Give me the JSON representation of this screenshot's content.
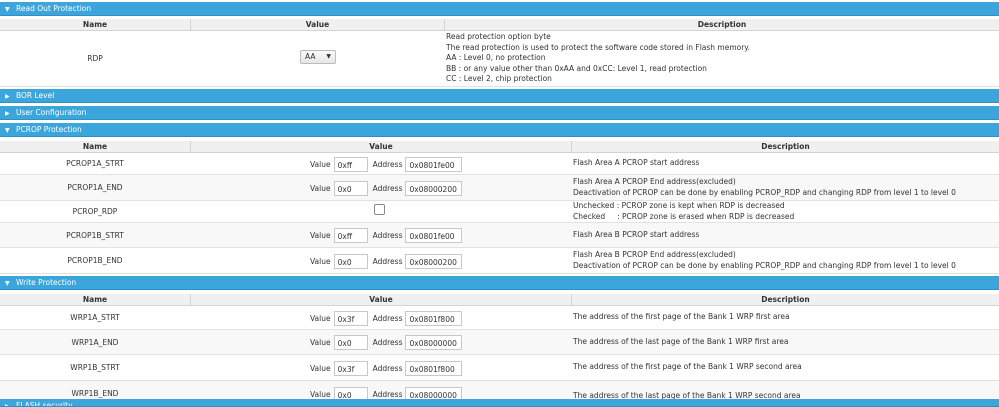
{
  "sections": {
    "rop": {
      "title": "Read Out Protection",
      "arrow": "▼"
    },
    "bor": {
      "title": "BOR Level",
      "arrow": "▶"
    },
    "user": {
      "title": "User Configuration",
      "arrow": "▶"
    },
    "pcrop": {
      "title": "PCROP Protection",
      "arrow": "▼"
    },
    "wrp": {
      "title": "Write Protection",
      "arrow": "▼"
    },
    "flash": {
      "title": "FLASH security",
      "arrow": "▶"
    }
  },
  "headers": {
    "name": "Name",
    "value": "Value",
    "description": "Description"
  },
  "labels": {
    "value": "Value",
    "address": "Address"
  },
  "rdp": {
    "name": "RDP",
    "selected": "AA",
    "desc": [
      "Read protection option byte",
      "The read protection is used to protect the software code stored in Flash memory.",
      "AA : Level 0, no protection",
      "BB : or any value other than 0xAA and 0xCC: Level 1, read protection",
      "CC : Level 2, chip protection"
    ]
  },
  "pcrop_rows": [
    {
      "name": "PCROP1A_STRT",
      "value": "0xff",
      "address": "0x0801fe00",
      "desc": [
        "Flash Area A PCROP start address"
      ]
    },
    {
      "name": "PCROP1A_END",
      "value": "0x0",
      "address": "0x08000200",
      "desc": [
        "Flash Area A PCROP End address(excluded)",
        "Deactivation of PCROP can be done by enabling PCROP_RDP and changing RDP from level 1 to level 0"
      ]
    },
    {
      "name": "PCROP_RDP",
      "checked": false,
      "desc": [
        "Unchecked : PCROP zone is kept when RDP is decreased",
        "Checked     : PCROP zone is erased when RDP is decreased"
      ]
    },
    {
      "name": "PCROP1B_STRT",
      "value": "0xff",
      "address": "0x0801fe00",
      "desc": [
        "Flash Area B PCROP start address"
      ]
    },
    {
      "name": "PCROP1B_END",
      "value": "0x0",
      "address": "0x08000200",
      "desc": [
        "Flash Area B PCROP End address(excluded)",
        "Deactivation of PCROP can be done by enabling PCROP_RDP and changing RDP from level 1 to level 0"
      ]
    }
  ],
  "wrp_rows": [
    {
      "name": "WRP1A_STRT",
      "value": "0x3f",
      "address": "0x0801f800",
      "desc": [
        "The address of the first page of the Bank 1 WRP first area"
      ]
    },
    {
      "name": "WRP1A_END",
      "value": "0x0",
      "address": "0x08000000",
      "desc": [
        "The address of the last page of the Bank 1 WRP first area"
      ]
    },
    {
      "name": "WRP1B_STRT",
      "value": "0x3f",
      "address": "0x0801f800",
      "desc": [
        "The address of the first page of the Bank 1 WRP second area"
      ]
    },
    {
      "name": "WRP1B_END",
      "value": "0x0",
      "address": "0x08000000",
      "desc": [
        "The address of the last page of the Bank 1 WRP second area"
      ]
    }
  ],
  "colors": {
    "section_bg": "#3ca6dc",
    "header_bg": "#f0f0f0",
    "row_alt": "#f8f8f8"
  }
}
